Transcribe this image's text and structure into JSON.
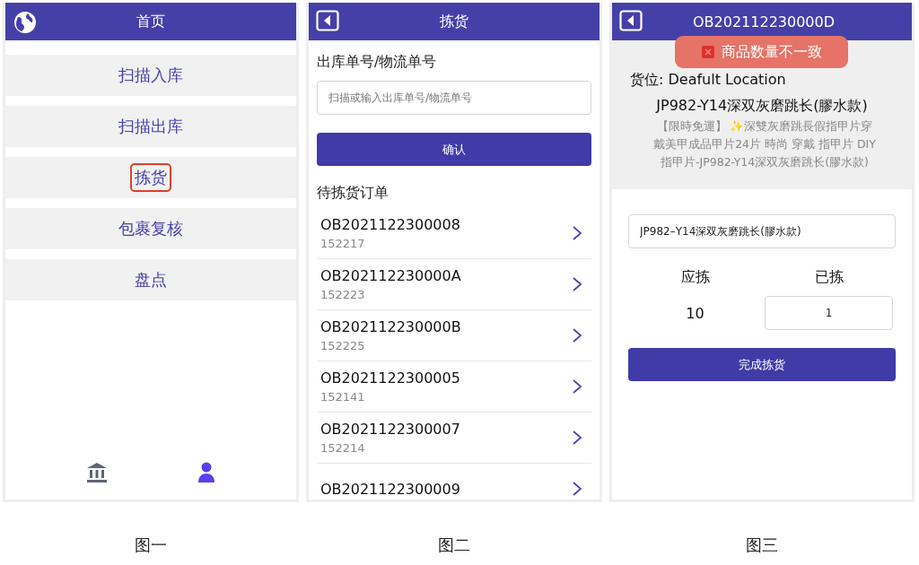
{
  "screens": [
    {
      "kind": "home",
      "header": {
        "title": "首页"
      },
      "menu": [
        {
          "label": "扫描入库",
          "highlighted": false
        },
        {
          "label": "扫描出库",
          "highlighted": false
        },
        {
          "label": "拣货",
          "highlighted": true
        },
        {
          "label": "包裹复核",
          "highlighted": false
        },
        {
          "label": "盘点",
          "highlighted": false
        }
      ],
      "tab_bar": [
        {
          "kind": "bank",
          "selected": false
        },
        {
          "kind": "user",
          "selected": true
        }
      ],
      "caption": "图一"
    },
    {
      "kind": "order_list",
      "header": {
        "title": "拣货"
      },
      "field_label": "出库单号/物流单号",
      "search": {
        "placeholder": "扫描或输入出库单号/物流单号"
      },
      "confirm_button": "确认",
      "section_title": "待拣货订单",
      "orders": [
        {
          "number": "OB2021122300008",
          "code": "152217"
        },
        {
          "number": "OB202112230000A",
          "code": "152223"
        },
        {
          "number": "OB202112230000B",
          "code": "152225"
        },
        {
          "number": "OB2021122300005",
          "code": "152141"
        },
        {
          "number": "OB2021122300007",
          "code": "152214"
        },
        {
          "number": "OB2021122300009"
        }
      ],
      "caption": "图二"
    },
    {
      "kind": "pick_detail",
      "header": {
        "title": "OB202112230000D"
      },
      "toast": "商品数量不一致",
      "location": "货位: Deafult Location",
      "product_name": "JP982-Y14深双灰磨跳长(膠水款)",
      "description": "【限時免運】 ✨深雙灰磨跳長假指甲片穿戴美甲成品甲片24片 時尚 穿戴 指甲片 DIY 指甲片-JP982-Y14深双灰磨跳长(膠水款)",
      "sku_field": {
        "value": "JP982–Y14深双灰磨跳长(膠水款)"
      },
      "required_label": "应拣",
      "required_value": "10",
      "picked_label": "已拣",
      "picked_field": {
        "value": "1"
      },
      "finish_button": "完成拣货",
      "caption": "图三"
    }
  ]
}
